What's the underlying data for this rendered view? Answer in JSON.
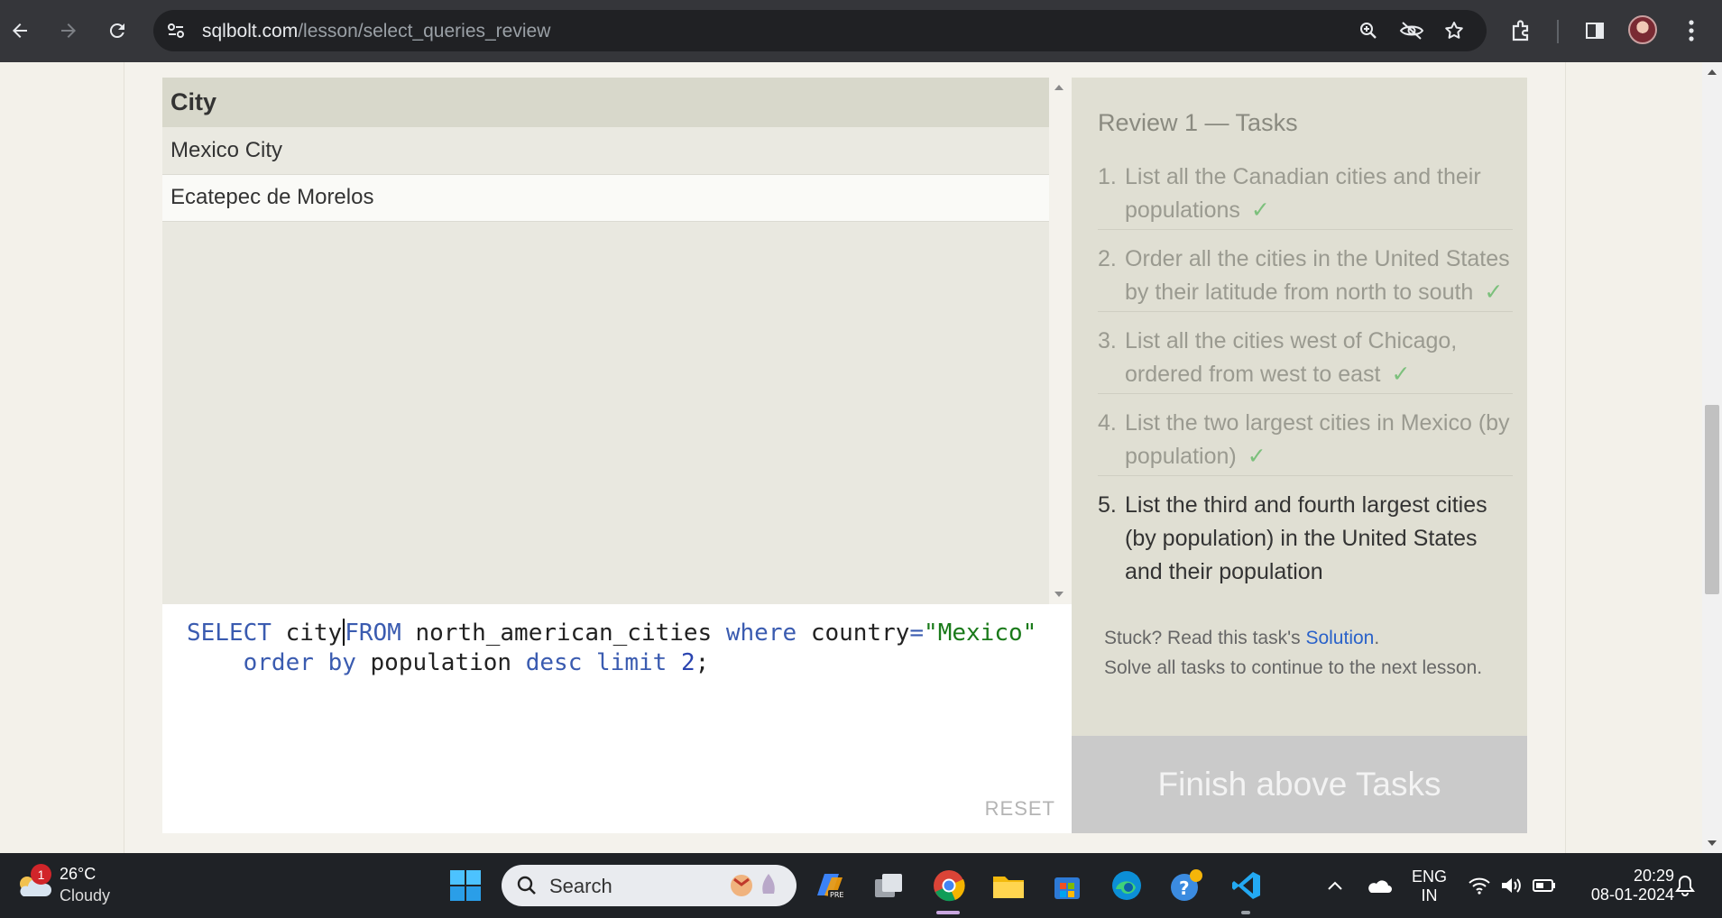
{
  "browser": {
    "url_domain": "sqlbolt.com",
    "url_path": "/lesson/select_queries_review"
  },
  "results": {
    "column": "City",
    "rows": [
      "Mexico City",
      "Ecatepec de Morelos"
    ]
  },
  "editor": {
    "line1": {
      "select": "SELECT",
      "col": "city",
      "from": "FROM",
      "table": "north_american_cities",
      "where": "where",
      "field": "country",
      "eq": "=",
      "value": "\"Mexico\""
    },
    "line2": {
      "order": "order",
      "by": "by",
      "field": "population",
      "desc": "desc",
      "limit": "limit",
      "n": "2",
      "end": ";"
    },
    "reset_label": "RESET"
  },
  "tasks": {
    "title": "Review 1 — Tasks",
    "items": [
      {
        "num": "1.",
        "text": "List all the Canadian cities and their populations",
        "check": "✓"
      },
      {
        "num": "2.",
        "text": "Order all the cities in the United States by their latitude from north to south",
        "check": "✓"
      },
      {
        "num": "3.",
        "text": "List all the cities west of Chicago, ordered from west to east",
        "check": "✓"
      },
      {
        "num": "4.",
        "text": "List the two largest cities in Mexico (by population)",
        "check": "✓"
      },
      {
        "num": "5.",
        "text": "List the third and fourth largest cities (by population) in the United States and their population",
        "check": ""
      }
    ],
    "stuck_prefix": "Stuck? Read this task's ",
    "solution_link": "Solution",
    "stuck_suffix": ".",
    "continue_text": "Solve all tasks to continue to the next lesson.",
    "finish_button": "Finish above Tasks"
  },
  "taskbar": {
    "temperature": "26°C",
    "weather": "Cloudy",
    "weather_badge": "1",
    "search_label": "Search",
    "lang_top": "ENG",
    "lang_bottom": "IN",
    "time": "20:29",
    "date": "08-01-2024"
  }
}
